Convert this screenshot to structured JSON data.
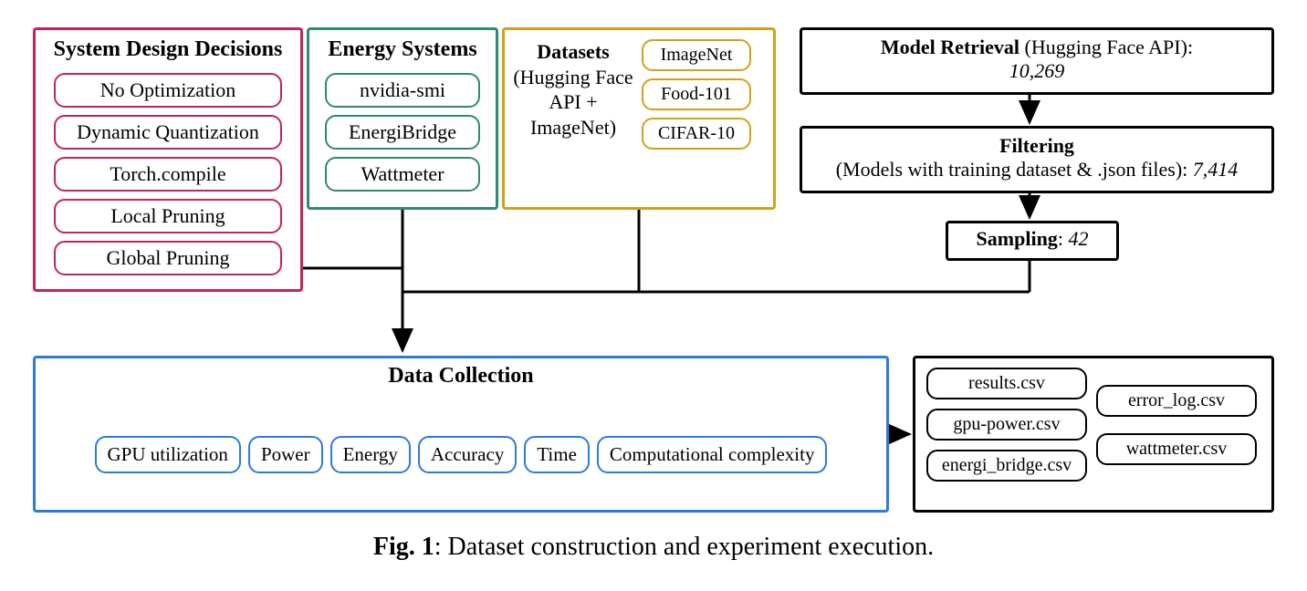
{
  "system_design": {
    "title": "System Design Decisions",
    "items": [
      "No Optimization",
      "Dynamic Quantization",
      "Torch.compile",
      "Local Pruning",
      "Global Pruning"
    ],
    "color": "#c0255f"
  },
  "energy_systems": {
    "title": "Energy  Systems",
    "items": [
      "nvidia-smi",
      "EnergiBridge",
      "Wattmeter"
    ],
    "color": "#2e8b6f"
  },
  "datasets": {
    "title_bold": "Datasets",
    "subtitle": "(Hugging Face API + ImageNet)",
    "items": [
      "ImageNet",
      "Food-101",
      "CIFAR-10"
    ],
    "color": "#d4a017"
  },
  "pipeline": {
    "retrieval": {
      "label_bold": "Model Retrieval",
      "label_rest": " (Hugging Face API):",
      "value": "10,269"
    },
    "filtering": {
      "label_bold": "Filtering",
      "detail": "(Models with training dataset & .json files): ",
      "value": "7,414"
    },
    "sampling": {
      "label_bold": "Sampling",
      "value": "42"
    }
  },
  "data_collection": {
    "title": "Data Collection",
    "metrics": [
      "GPU utilization",
      "Power",
      "Energy",
      "Accuracy",
      "Time",
      "Computational complexity"
    ],
    "color": "#2b7bdc"
  },
  "outputs": {
    "left": [
      "results.csv",
      "gpu-power.csv",
      "energi_bridge.csv"
    ],
    "right": [
      "error_log.csv",
      "wattmeter.csv"
    ]
  },
  "caption": {
    "bold": "Fig. 1",
    "rest": ": Dataset construction and experiment execution."
  }
}
